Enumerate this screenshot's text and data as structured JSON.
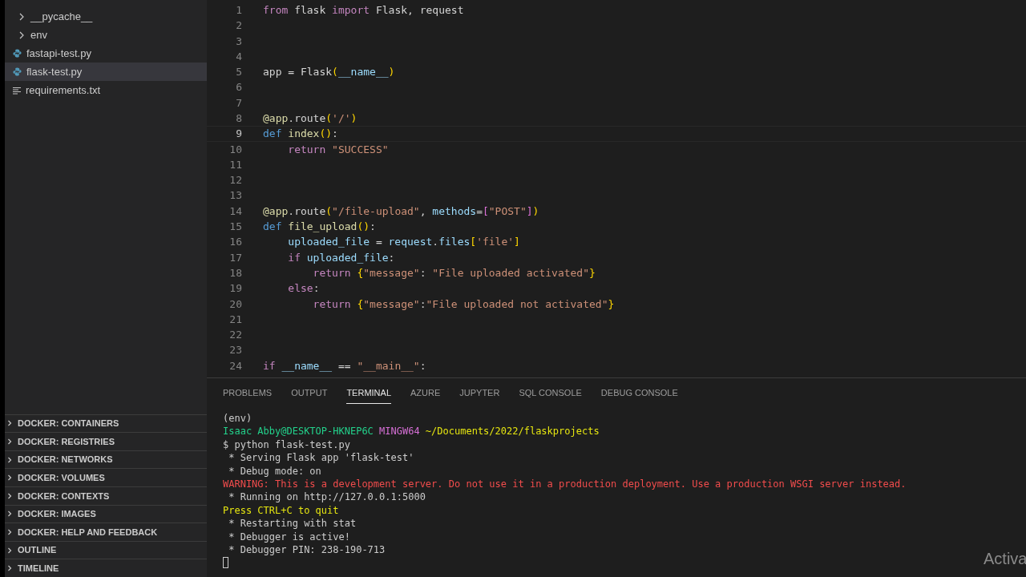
{
  "explorer": {
    "items": [
      {
        "label": "__pycache__",
        "kind": "folder",
        "selected": false
      },
      {
        "label": "env",
        "kind": "folder",
        "selected": false
      },
      {
        "label": "fastapi-test.py",
        "kind": "python",
        "selected": false
      },
      {
        "label": "flask-test.py",
        "kind": "python",
        "selected": true
      },
      {
        "label": "requirements.txt",
        "kind": "text",
        "selected": false
      }
    ]
  },
  "sections": [
    {
      "label": "DOCKER: CONTAINERS",
      "expanded": false
    },
    {
      "label": "DOCKER: REGISTRIES",
      "expanded": false
    },
    {
      "label": "DOCKER: NETWORKS",
      "expanded": false
    },
    {
      "label": "DOCKER: VOLUMES",
      "expanded": false
    },
    {
      "label": "DOCKER: CONTEXTS",
      "expanded": false
    },
    {
      "label": "DOCKER: IMAGES",
      "expanded": false
    },
    {
      "label": "DOCKER: HELP AND FEEDBACK",
      "expanded": false
    },
    {
      "label": "OUTLINE",
      "expanded": false
    },
    {
      "label": "TIMELINE",
      "expanded": false
    }
  ],
  "editor": {
    "lines": [
      {
        "number": "1",
        "current": false,
        "tokens": [
          {
            "kind": "kw",
            "text": "from"
          },
          {
            "kind": "plain",
            "text": " flask "
          },
          {
            "kind": "kw",
            "text": "import"
          },
          {
            "kind": "plain",
            "text": " Flask, request"
          }
        ]
      },
      {
        "number": "2",
        "current": false
      },
      {
        "number": "3",
        "current": false
      },
      {
        "number": "4",
        "current": false
      },
      {
        "number": "5",
        "current": false,
        "tokens": [
          {
            "kind": "plain",
            "text": "app = Flask"
          },
          {
            "kind": "br1",
            "text": "("
          },
          {
            "kind": "var",
            "text": "__name__"
          },
          {
            "kind": "br1",
            "text": ")"
          }
        ]
      },
      {
        "number": "6",
        "current": false
      },
      {
        "number": "7",
        "current": false
      },
      {
        "number": "8",
        "current": false,
        "tokens": [
          {
            "kind": "fn",
            "text": "@app"
          },
          {
            "kind": "plain",
            "text": ".route"
          },
          {
            "kind": "br1",
            "text": "("
          },
          {
            "kind": "str",
            "text": "'/'"
          },
          {
            "kind": "br1",
            "text": ")"
          }
        ]
      },
      {
        "number": "9",
        "current": true,
        "tokens": [
          {
            "kind": "def",
            "text": "def"
          },
          {
            "kind": "fn",
            "text": " index"
          },
          {
            "kind": "br1",
            "text": "()"
          },
          {
            "kind": "plain",
            "text": ":"
          }
        ]
      },
      {
        "number": "10",
        "current": false,
        "tokens": [
          {
            "kind": "kw",
            "text": "    return"
          },
          {
            "kind": "str",
            "text": " \"SUCCESS\""
          }
        ]
      },
      {
        "number": "11",
        "current": false
      },
      {
        "number": "12",
        "current": false
      },
      {
        "number": "13",
        "current": false
      },
      {
        "number": "14",
        "current": false,
        "tokens": [
          {
            "kind": "fn",
            "text": "@app"
          },
          {
            "kind": "plain",
            "text": ".route"
          },
          {
            "kind": "br1",
            "text": "("
          },
          {
            "kind": "str",
            "text": "\"/file-upload\""
          },
          {
            "kind": "plain",
            "text": ", "
          },
          {
            "kind": "var",
            "text": "methods"
          },
          {
            "kind": "plain",
            "text": "="
          },
          {
            "kind": "br2",
            "text": "["
          },
          {
            "kind": "str",
            "text": "\"POST\""
          },
          {
            "kind": "br2",
            "text": "]"
          },
          {
            "kind": "br1",
            "text": ")"
          }
        ]
      },
      {
        "number": "15",
        "current": false,
        "tokens": [
          {
            "kind": "def",
            "text": "def"
          },
          {
            "kind": "fn",
            "text": " file_upload"
          },
          {
            "kind": "br1",
            "text": "()"
          },
          {
            "kind": "plain",
            "text": ":"
          }
        ]
      },
      {
        "number": "16",
        "current": false,
        "tokens": [
          {
            "kind": "var",
            "text": "    uploaded_file"
          },
          {
            "kind": "plain",
            "text": " = "
          },
          {
            "kind": "var",
            "text": "request"
          },
          {
            "kind": "plain",
            "text": "."
          },
          {
            "kind": "var",
            "text": "files"
          },
          {
            "kind": "br1",
            "text": "["
          },
          {
            "kind": "str",
            "text": "'file'"
          },
          {
            "kind": "br1",
            "text": "]"
          }
        ]
      },
      {
        "number": "17",
        "current": false,
        "tokens": [
          {
            "kind": "kw",
            "text": "    if"
          },
          {
            "kind": "var",
            "text": " uploaded_file"
          },
          {
            "kind": "plain",
            "text": ":"
          }
        ]
      },
      {
        "number": "18",
        "current": false,
        "tokens": [
          {
            "kind": "kw",
            "text": "        return"
          },
          {
            "kind": "br1",
            "text": " {"
          },
          {
            "kind": "str",
            "text": "\"message\""
          },
          {
            "kind": "plain",
            "text": ": "
          },
          {
            "kind": "str",
            "text": "\"File uploaded activated\""
          },
          {
            "kind": "br1",
            "text": "}"
          }
        ]
      },
      {
        "number": "19",
        "current": false,
        "tokens": [
          {
            "kind": "kw",
            "text": "    else"
          },
          {
            "kind": "plain",
            "text": ":"
          }
        ]
      },
      {
        "number": "20",
        "current": false,
        "tokens": [
          {
            "kind": "kw",
            "text": "        return"
          },
          {
            "kind": "br1",
            "text": " {"
          },
          {
            "kind": "str",
            "text": "\"message\""
          },
          {
            "kind": "plain",
            "text": ":"
          },
          {
            "kind": "str",
            "text": "\"File uploaded not activated\""
          },
          {
            "kind": "br1",
            "text": "}"
          }
        ]
      },
      {
        "number": "21",
        "current": false
      },
      {
        "number": "22",
        "current": false
      },
      {
        "number": "23",
        "current": false
      },
      {
        "number": "24",
        "current": false,
        "tokens": [
          {
            "kind": "kw",
            "text": "if"
          },
          {
            "kind": "var",
            "text": " __name__"
          },
          {
            "kind": "plain",
            "text": " == "
          },
          {
            "kind": "str",
            "text": "\"__main__\""
          },
          {
            "kind": "plain",
            "text": ":"
          }
        ]
      }
    ]
  },
  "panel": {
    "tabs": [
      {
        "label": "PROBLEMS",
        "selected": false
      },
      {
        "label": "OUTPUT",
        "selected": false
      },
      {
        "label": "TERMINAL",
        "selected": true
      },
      {
        "label": "AZURE",
        "selected": false
      },
      {
        "label": "JUPYTER",
        "selected": false
      },
      {
        "label": "SQL CONSOLE",
        "selected": false
      },
      {
        "label": "DEBUG CONSOLE",
        "selected": false
      }
    ],
    "terminal": [
      [
        {
          "kind": "plain",
          "text": "(env)"
        }
      ],
      [
        {
          "kind": "green",
          "text": "Isaac Abby@DESKTOP-HKNEP6C"
        },
        {
          "kind": "magenta",
          "text": " MINGW64"
        },
        {
          "kind": "yellow",
          "text": " ~/Documents/2022/flaskprojects"
        }
      ],
      [
        {
          "kind": "plain",
          "text": "$ python flask-test.py"
        }
      ],
      [
        {
          "kind": "plain",
          "text": " * Serving Flask app 'flask-test'"
        }
      ],
      [
        {
          "kind": "plain",
          "text": " * Debug mode: on"
        }
      ],
      [
        {
          "kind": "red",
          "text": "WARNING: This is a development server. Do not use it in a production deployment. Use a production WSGI server instead."
        }
      ],
      [
        {
          "kind": "plain",
          "text": " * Running on http://127.0.0.1:5000"
        }
      ],
      [
        {
          "kind": "yellow",
          "text": "Press CTRL+C to quit"
        }
      ],
      [
        {
          "kind": "plain",
          "text": " * Restarting with stat"
        }
      ],
      [
        {
          "kind": "plain",
          "text": " * Debugger is active!"
        }
      ],
      [
        {
          "kind": "plain",
          "text": " * Debugger PIN: 238-190-713"
        }
      ]
    ]
  },
  "overlay": {
    "text": "Activa"
  }
}
